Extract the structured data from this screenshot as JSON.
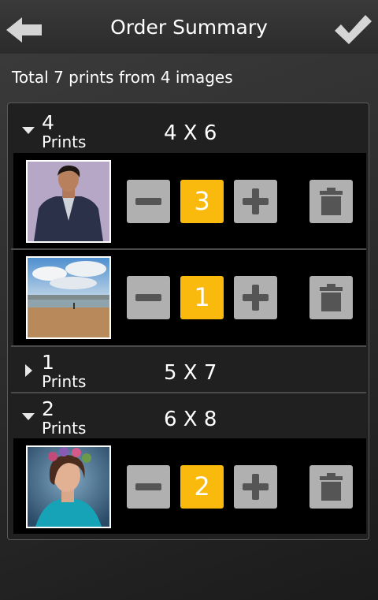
{
  "header": {
    "title": "Order Summary"
  },
  "summary": {
    "text": "Total 7 prints from 4 images"
  },
  "groups": [
    {
      "count": "4",
      "unit": "Prints",
      "size": "4 X 6",
      "expanded": true,
      "items": [
        {
          "qty": "3",
          "image": "man-portrait"
        },
        {
          "qty": "1",
          "image": "beach"
        }
      ]
    },
    {
      "count": "1",
      "unit": "Prints",
      "size": "5 X 7",
      "expanded": false,
      "items": []
    },
    {
      "count": "2",
      "unit": "Prints",
      "size": "6 X 8",
      "expanded": true,
      "items": [
        {
          "qty": "2",
          "image": "woman-portrait"
        }
      ]
    }
  ],
  "colors": {
    "qty_accent": "#f9b90d",
    "button_gray": "#b0b0b0"
  }
}
